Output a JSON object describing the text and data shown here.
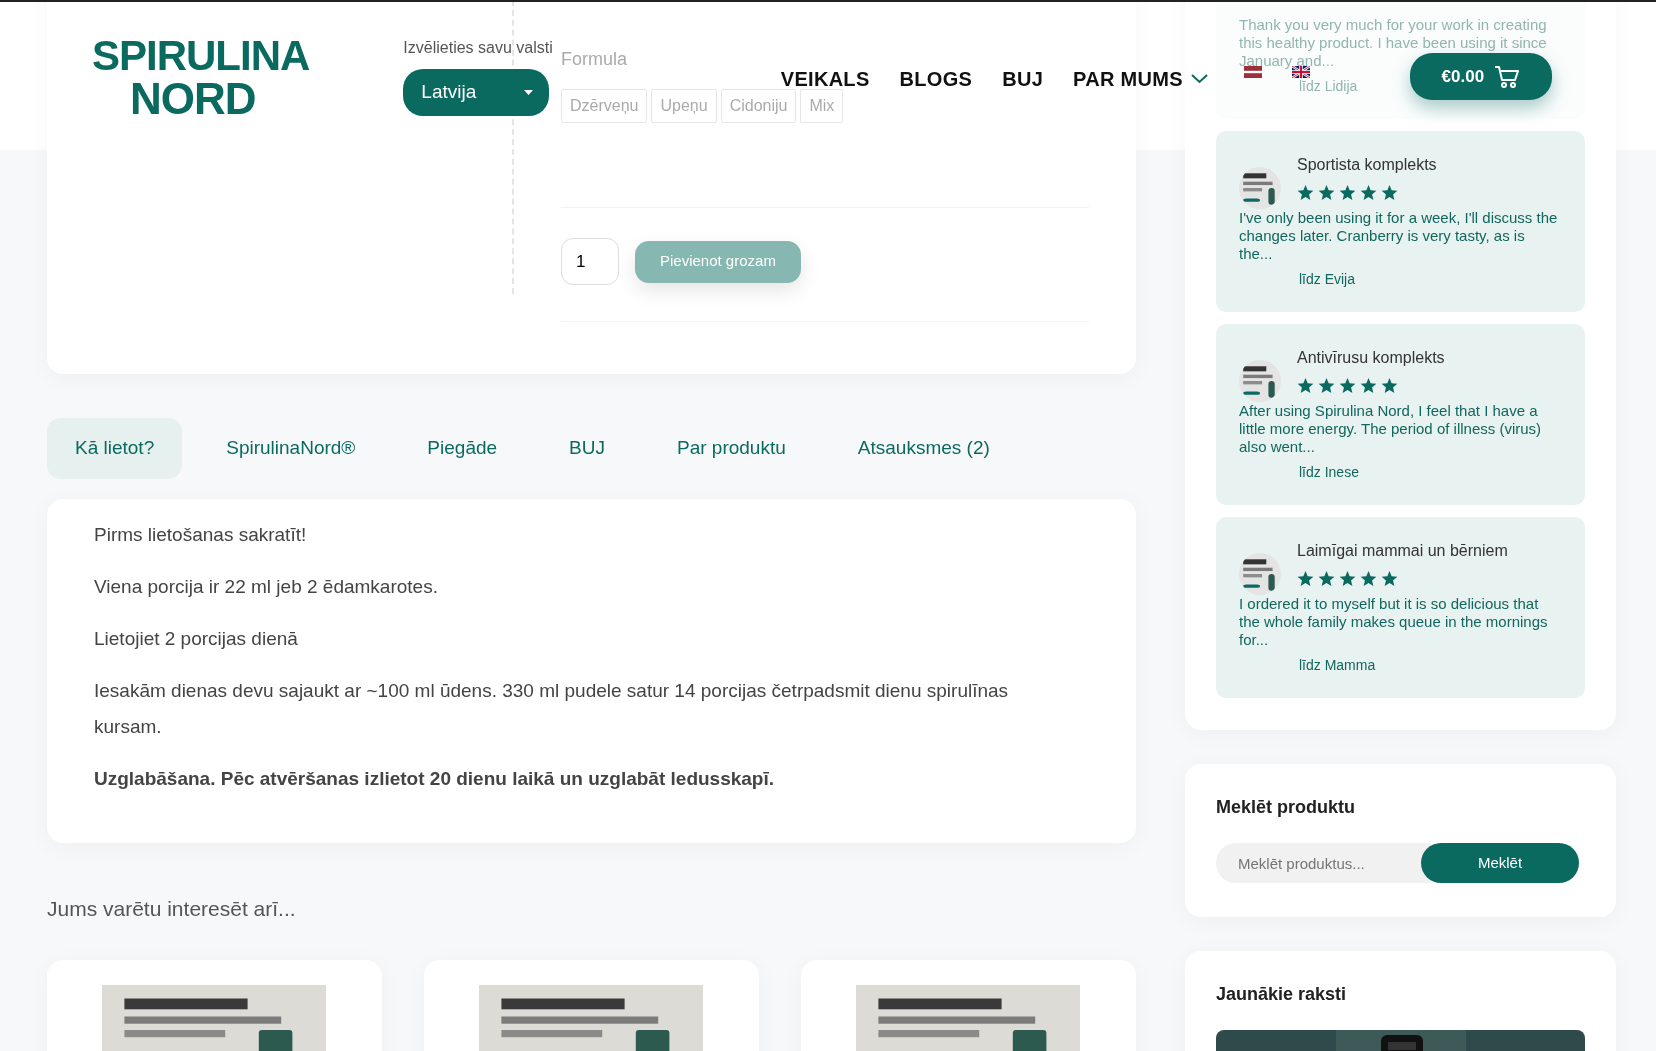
{
  "header": {
    "logo": [
      "SPIRULINA",
      "NORD"
    ],
    "country_label": "Izvēlieties savu valsti",
    "country_select": "Latvija",
    "nav": [
      {
        "label": "VEIKALS",
        "dropdown": false
      },
      {
        "label": "BLOGS",
        "dropdown": false
      },
      {
        "label": "BUJ",
        "dropdown": false
      },
      {
        "label": "PAR MUMS",
        "dropdown": true
      }
    ],
    "languages": [
      {
        "kind": "lv"
      },
      {
        "kind": "uk"
      }
    ],
    "cart_total": "€0.00"
  },
  "product": {
    "formula_label": "Formula",
    "flavors": [
      {
        "label": "Dzērveņu"
      },
      {
        "label": "Upeņu"
      },
      {
        "label": "Cidoniju"
      },
      {
        "label": "Mix"
      }
    ],
    "quantity": "1",
    "add_to_cart": "Pievienot grozam"
  },
  "tabs": [
    {
      "label": "Kā lietot?",
      "selected": true
    },
    {
      "label": "SpirulinaNord®",
      "selected": false
    },
    {
      "label": "Piegāde",
      "selected": false
    },
    {
      "label": "BUJ",
      "selected": false
    },
    {
      "label": "Par produktu",
      "selected": false
    },
    {
      "label": "Atsauksmes (2)",
      "selected": false
    }
  ],
  "tab_content": [
    {
      "text": "Pirms lietošanas sakratīt!",
      "bold": false
    },
    {
      "text": "Viena porcija ir 22 ml jeb 2 ēdamkarotes.",
      "bold": false
    },
    {
      "text": "Lietojiet 2 porcijas dienā",
      "bold": false
    },
    {
      "text": "Iesakām dienas devu sajaukt ar ~100 ml ūdens. 330 ml pudele satur 14 porcijas četrpadsmit dienu spirulīnas kursam.",
      "bold": false
    },
    {
      "text": "Uzglabāšana. Pēc atvēršanas izlietot 20 dienu laikā un uzglabāt ledusskapī.",
      "bold": true
    }
  ],
  "related": {
    "title": "Jums varētu interesēt arī..."
  },
  "reviews": [
    {
      "text": "Thank you very much for your work in creating this healthy product. I have been using it since January and...",
      "author": "līdz Lidija"
    },
    {
      "title": "Sportista komplekts",
      "stars": 5,
      "text": "I've only been using it for a week, I'll discuss the changes later. Cranberry is very tasty, as is the...",
      "author": "līdz Evija"
    },
    {
      "title": "Antivīrusu komplekts",
      "stars": 5,
      "text": "After using Spirulina Nord, I feel that I have a little more energy. The period of illness (virus) also went...",
      "author": "līdz Inese"
    },
    {
      "title": "Laimīgai mammai un bērniem",
      "stars": 5,
      "text": "I ordered it to myself but it is so delicious that the whole family makes queue in the mornings for...",
      "author": "līdz Mamma"
    }
  ],
  "search": {
    "title": "Meklēt produktu",
    "placeholder": "Meklēt produktus...",
    "button": "Meklēt"
  },
  "latest_posts": {
    "title": "Jaunākie raksti"
  }
}
